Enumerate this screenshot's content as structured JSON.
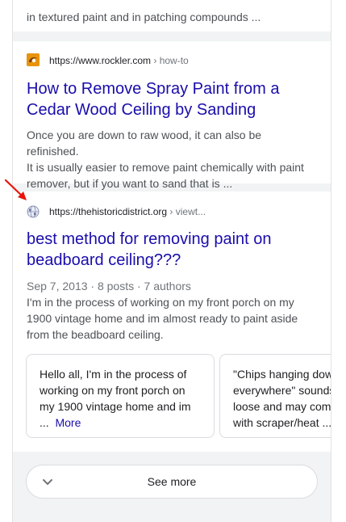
{
  "prev_result": {
    "snippet": "in textured paint and in patching compounds ..."
  },
  "result1": {
    "domain": "https://www.rockler.com",
    "path": " › how-to",
    "title_line1": "How to Remove Spray Paint from a",
    "title_line2": "Cedar Wood Ceiling by Sanding",
    "snippet_line1": "Once you are down to raw wood, it can also be refinished.",
    "snippet_line2": "It is usually easier to remove paint chemically with paint",
    "snippet_line3": "remover, but if you want to sand that is ...",
    "favicon": "rockler-logo-icon",
    "favicon_color": "#e8930c"
  },
  "result2": {
    "domain": "https://thehistoricdistrict.org",
    "path": " › viewt...",
    "title_line1": "best method for removing paint on",
    "title_line2": "beadboard ceiling???",
    "meta": "Sep 7, 2013 · 8 posts · 7 authors",
    "snippet_line1": "I'm in the process of working on my front porch on my",
    "snippet_line2": "1900 vintage home and im almost ready to paint aside",
    "snippet_line3": "from the beadboard ceiling.",
    "favicon": "globe-icon",
    "forum_posts": [
      {
        "line1": "Hello all, I'm in the process of",
        "line2": "working on my front porch on",
        "line3": "my 1900 vintage home and im",
        "line4_prefix": "...",
        "more": "More"
      },
      {
        "line1": "\"Chips hanging dow",
        "line2": "everywhere\" sounds",
        "line3": "loose and may com",
        "line4": "with scraper/heat ..."
      }
    ]
  },
  "see_more": {
    "label": "See more",
    "icon": "chevron-down-icon"
  },
  "annotation": {
    "icon": "red-arrow-icon",
    "color": "#e8140c"
  },
  "colors": {
    "link": "#1a0dab",
    "text": "#4d5156",
    "page_bg": "#f1f3f4"
  }
}
